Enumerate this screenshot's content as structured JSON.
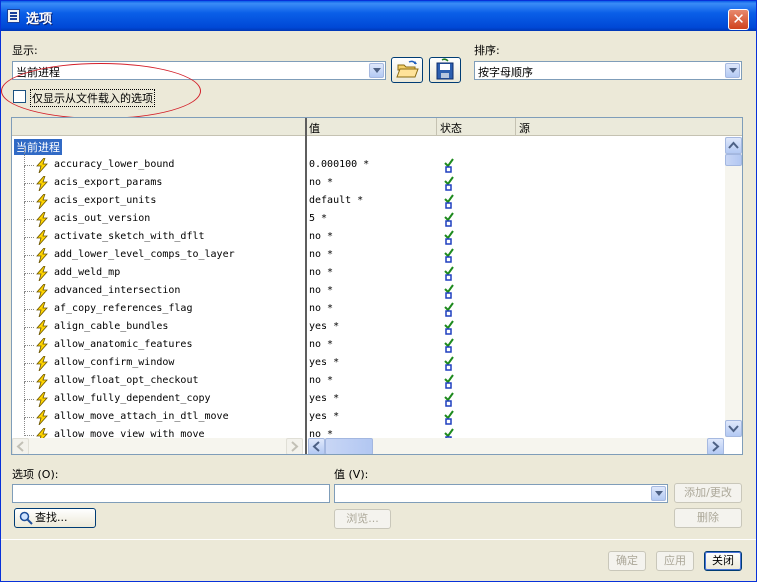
{
  "window": {
    "title": "选项"
  },
  "display": {
    "label": "显示:",
    "selected": "当前进程"
  },
  "sort": {
    "label": "排序:",
    "selected": "按字母顺序"
  },
  "filter": {
    "checkbox_label": "仅显示从文件载入的选项",
    "checked": false
  },
  "table": {
    "headers": {
      "value": "值",
      "status": "状态",
      "source": "源"
    },
    "root": "当前进程",
    "rows": [
      {
        "name": "accuracy_lower_bound",
        "value": "0.000100 *"
      },
      {
        "name": "acis_export_params",
        "value": "no *"
      },
      {
        "name": "acis_export_units",
        "value": "default *"
      },
      {
        "name": "acis_out_version",
        "value": "5 *"
      },
      {
        "name": "activate_sketch_with_dflt",
        "value": "no *"
      },
      {
        "name": "add_lower_level_comps_to_layer",
        "value": "no *"
      },
      {
        "name": "add_weld_mp",
        "value": "no *"
      },
      {
        "name": "advanced_intersection",
        "value": "no *"
      },
      {
        "name": "af_copy_references_flag",
        "value": "no *"
      },
      {
        "name": "align_cable_bundles",
        "value": "yes *"
      },
      {
        "name": "allow_anatomic_features",
        "value": "no *"
      },
      {
        "name": "allow_confirm_window",
        "value": "yes *"
      },
      {
        "name": "allow_float_opt_checkout",
        "value": "no *"
      },
      {
        "name": "allow_fully_dependent_copy",
        "value": "yes *"
      },
      {
        "name": "allow_move_attach_in_dtl_move",
        "value": "yes *"
      },
      {
        "name": "allow_move_view_with_move",
        "value": "no *"
      }
    ]
  },
  "option_field": {
    "label": "选项 (O):",
    "value": ""
  },
  "value_field": {
    "label": "值 (V):",
    "value": ""
  },
  "buttons": {
    "add_change": "添加/更改",
    "find": "查找...",
    "browse": "浏览...",
    "delete": "删除",
    "ok": "确定",
    "apply": "应用",
    "close": "关闭"
  },
  "colors": {
    "titlebar": "#0a5fe8",
    "selection": "#316ac5",
    "annotation": "#d3202a",
    "status_check": "#1e8a1e"
  }
}
